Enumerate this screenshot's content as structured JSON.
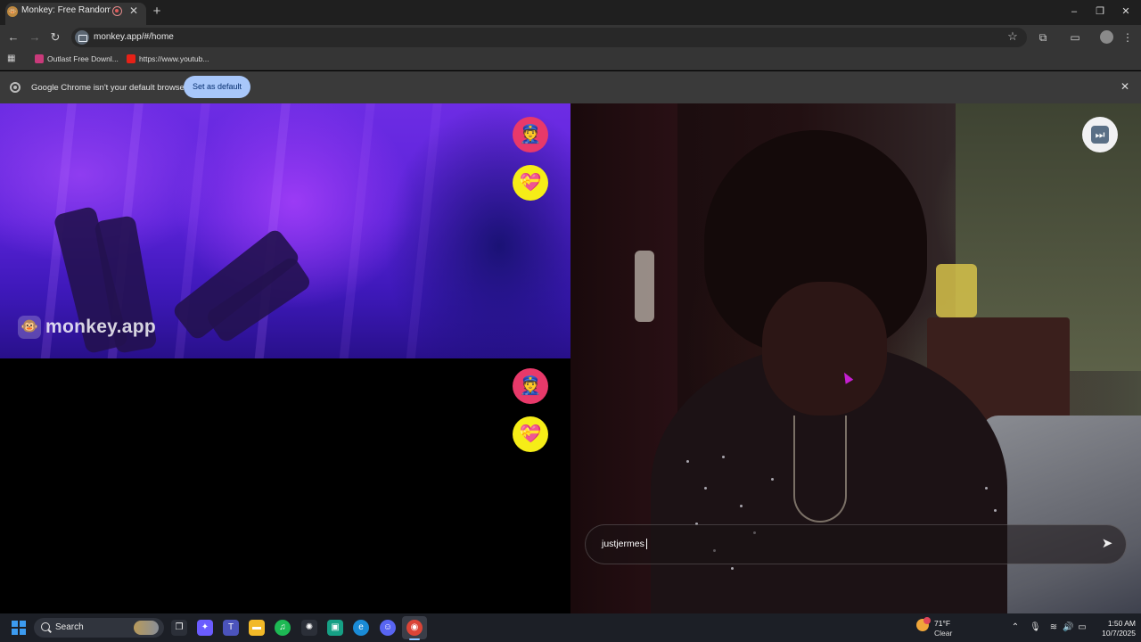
{
  "browser": {
    "tab": {
      "title": "Monkey: Free Random Video Chat",
      "favicon": "monkey-favicon",
      "recording_indicator": "record-icon"
    },
    "new_tab_glyph": "+",
    "window_controls": {
      "minimize": "–",
      "restore": "❐",
      "close": "✕"
    },
    "url": "monkey.app/#/home",
    "bookmarks": [
      {
        "label": "Outlast Free Downl...",
        "favicon_color": "#c93a7a"
      },
      {
        "label": "https://www.youtub...",
        "favicon_color": "#e62117"
      }
    ],
    "infobar": {
      "message": "Google Chrome isn't your default browser",
      "button": "Set as default",
      "close_glyph": "✕"
    }
  },
  "app": {
    "brand": "monkey.app",
    "logo_glyph": "🐵",
    "report_emoji": "👮",
    "like_emoji": "💝",
    "skip_glyph": "⏭",
    "chat": {
      "value": "justjermes",
      "send_glyph": "➤"
    },
    "colors": {
      "report_button": "#e8396a",
      "like_button": "#f6ed17",
      "skip_button": "#f1f1f3"
    }
  },
  "taskbar": {
    "search_label": "Search",
    "apps": [
      {
        "name": "task-view",
        "glyph": "❐",
        "color": "#2b2f38"
      },
      {
        "name": "copilot",
        "glyph": "✦",
        "color": "#6b5cff"
      },
      {
        "name": "teams",
        "glyph": "T",
        "color": "#4b53bc"
      },
      {
        "name": "file-explorer",
        "glyph": "▬",
        "color": "#f2b928"
      },
      {
        "name": "spotify",
        "glyph": "♫",
        "color": "#1db954"
      },
      {
        "name": "chatgpt",
        "glyph": "✺",
        "color": "#2b2f38"
      },
      {
        "name": "clipchamp",
        "glyph": "▣",
        "color": "#16a085"
      },
      {
        "name": "edge",
        "glyph": "e",
        "color": "#1a8bd6"
      },
      {
        "name": "discord",
        "glyph": "☺",
        "color": "#5865f2"
      },
      {
        "name": "chrome",
        "glyph": "◉",
        "color": "#db4437"
      }
    ],
    "weather": {
      "temp": "71°F",
      "condition": "Clear"
    },
    "tray": {
      "chevron": "⌃",
      "mic": "🎙",
      "wifi": "≋",
      "volume": "🔊",
      "battery": "▭"
    },
    "time": "1:50 AM",
    "date": "10/7/2025"
  }
}
